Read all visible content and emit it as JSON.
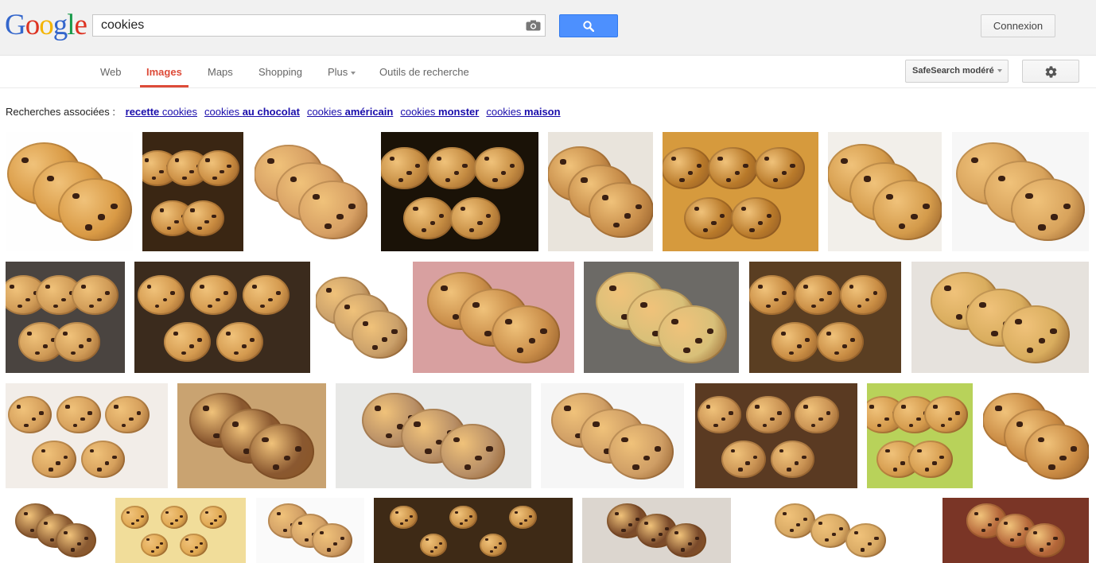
{
  "logo": {
    "text": "Google",
    "letters": [
      {
        "ch": "G",
        "color": "#3366cc"
      },
      {
        "ch": "o",
        "color": "#dd3322"
      },
      {
        "ch": "o",
        "color": "#f4b400"
      },
      {
        "ch": "g",
        "color": "#3366cc"
      },
      {
        "ch": "l",
        "color": "#189a4a"
      },
      {
        "ch": "e",
        "color": "#dd3322"
      }
    ]
  },
  "search": {
    "query": "cookies",
    "camera_icon": "camera-icon",
    "button_icon": "search-icon"
  },
  "header": {
    "signin_label": "Connexion"
  },
  "nav": {
    "tabs": [
      {
        "label": "Web"
      },
      {
        "label": "Images",
        "active": true
      },
      {
        "label": "Maps"
      },
      {
        "label": "Shopping"
      },
      {
        "label": "Plus"
      },
      {
        "label": "Outils de recherche"
      }
    ],
    "safesearch_label": "SafeSearch modéré",
    "settings_icon": "gear-icon"
  },
  "related": {
    "prefix": "Recherches associées :",
    "links": [
      {
        "pre": "",
        "bold": "recette",
        "post": " cookies"
      },
      {
        "pre": "cookies ",
        "bold": "au chocolat",
        "post": ""
      },
      {
        "pre": "cookies ",
        "bold": "américain",
        "post": ""
      },
      {
        "pre": "cookies ",
        "bold": "monster",
        "post": ""
      },
      {
        "pre": "cookies ",
        "bold": "maison",
        "post": ""
      }
    ]
  },
  "colors": {
    "accent_red": "#dd4b39",
    "link_blue": "#1a0dab",
    "search_blue": "#4d90fe"
  }
}
